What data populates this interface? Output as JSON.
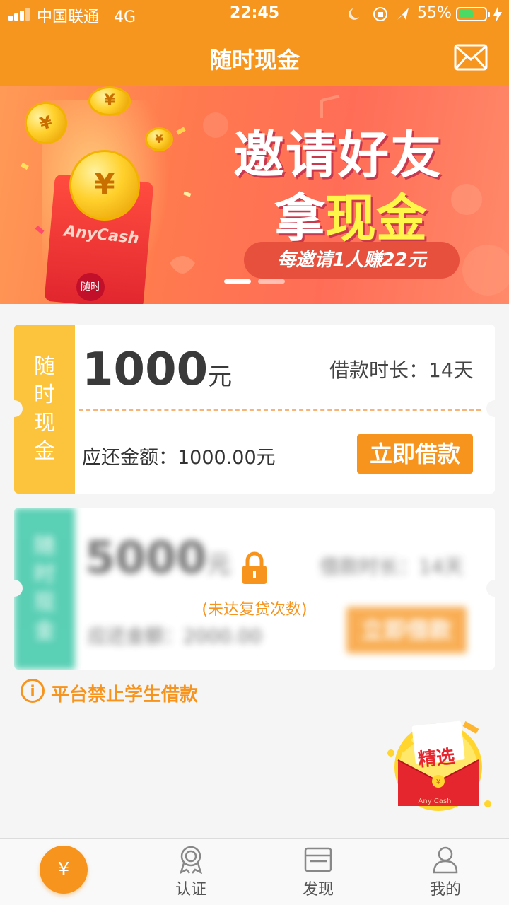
{
  "status_bar": {
    "carrier": "中国联通",
    "network": "4G",
    "time": "22:45",
    "battery": "55%"
  },
  "header": {
    "title": "随时现金",
    "mail_icon": "mail-icon"
  },
  "banner": {
    "headline_line1": "邀请好友",
    "headline_line2_prefix": "拿",
    "headline_line2_highlight": "现金",
    "subtitle": "每邀请1人赚22元",
    "brand": "AnyCash",
    "seal": "随时",
    "coin_symbol": "¥",
    "active_slide": 1,
    "slide_count": 2
  },
  "loan_card": {
    "side_label": [
      "随",
      "时",
      "现",
      "金"
    ],
    "amount": "1000",
    "unit": "元",
    "term": "借款时长：14天",
    "repay": "应还金额：1000.00元",
    "button": "立即借款"
  },
  "locked_card": {
    "side_label": [
      "随",
      "时",
      "现",
      "金"
    ],
    "amount": "5000",
    "unit": "元",
    "term": "借款时长：14天",
    "repay": "应还金额：2000.00",
    "button": "立即借款",
    "lock_text": "(未达复贷次数)"
  },
  "notice": {
    "text": "平台禁止学生借款"
  },
  "promo": {
    "label": "精选",
    "brand": "Any Cash"
  },
  "tabbar": {
    "home_icon": "¥",
    "items": [
      {
        "label": "认证"
      },
      {
        "label": "发现"
      },
      {
        "label": "我的"
      }
    ]
  },
  "colors": {
    "primary": "#f7961f",
    "side_yellow": "#fcc33c",
    "side_teal": "#23c09c",
    "banner": "#ff7a4e"
  }
}
